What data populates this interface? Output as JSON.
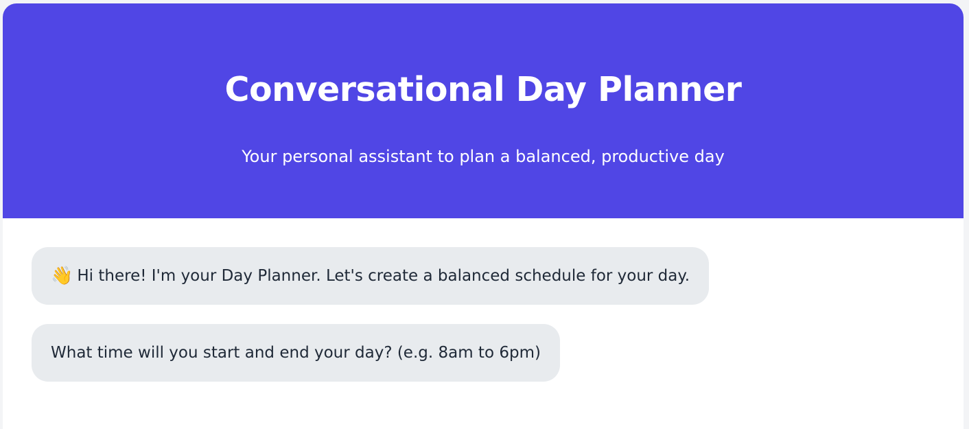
{
  "header": {
    "title": "Conversational Day Planner",
    "subtitle": "Your personal assistant to plan a balanced, productive day"
  },
  "messages": [
    {
      "icon": "👋",
      "icon_name": "waving-hand-icon",
      "text": "Hi there! I'm your Day Planner. Let's create a balanced schedule for your day."
    },
    {
      "text": "What time will you start and end your day? (e.g. 8am to 6pm)"
    }
  ],
  "colors": {
    "header_bg": "#5046e5",
    "bubble_bg": "#e8ebee",
    "text": "#1f2937"
  }
}
